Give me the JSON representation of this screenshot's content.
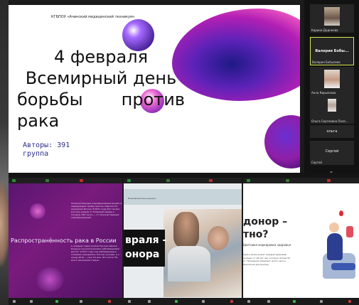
{
  "main_slide": {
    "organization": "КГБПОУ «Ачинский медицинский техникум»",
    "title_lines": [
      "4 февраля",
      "Всемирный день",
      "борьбы",
      "против",
      "рака"
    ],
    "authors_line1": "Авторы: 391",
    "authors_line2": "группа"
  },
  "participants": [
    {
      "name": "Карина Доднкова"
    },
    {
      "center_name": "Валерия Бобы...",
      "name": "Валерия Бобылева"
    },
    {
      "name": "Анна Кирьянова"
    },
    {
      "name": "Ольга Сергеевна Поле..."
    },
    {
      "name": "ольга"
    },
    {
      "name": "Сергей"
    }
  ],
  "screens": [
    {
      "heading": "Распространённость рака в России",
      "col_text_1": "Злокачественные новообразования входят в лидирующую тройку причин смертности населения России. В 2021 году 941 тысяча россиян умерли от болезней сердца и сосудов, 299 тысяч — от злокачественных новообразований.",
      "col_text_2": "С каждым годом количество российских больных онкологическими заболеваниями растет: в 2017 году под наблюдением в клиниках находились 3,6 млн человек, а к концу 2019 — уже 3,9 млн. Это почти 3% всего населения страны."
    },
    {
      "small_head": "Всемирный день донора",
      "big_line1": "враля -",
      "big_line2": "онора"
    },
    {
      "title_line1": "донор –",
      "title_line2": "тно?",
      "subtitle": "Цветовая маркировка здоровья",
      "body": "Сдать кровь может каждый здоровый человек от 18 лет, вес которого более 50 кг. Процедура занимает около часа и безопасна для донора."
    }
  ],
  "colors": {
    "active_tile_border": "#d7e84a",
    "slide_purple": "#7a1b7e",
    "accent_red": "#e02a3a"
  }
}
